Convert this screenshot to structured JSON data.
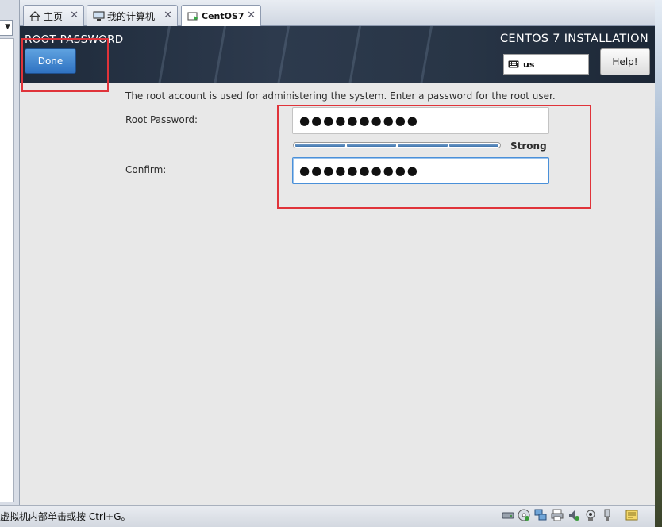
{
  "tabs": [
    {
      "label": "主页",
      "icon": "home-icon"
    },
    {
      "label": "我的计算机",
      "icon": "computer-icon"
    },
    {
      "label": "CentOS7",
      "icon": "vm-icon"
    }
  ],
  "close_glyph": "✕",
  "dropdown_glyph": "▼",
  "screen_title": "ROOT PASSWORD",
  "done_label": "Done",
  "install_title": "CENTOS 7 INSTALLATION",
  "keyboard_layout": "us",
  "help_label": "Help!",
  "description": "The root account is used for administering the system.  Enter a password for the root user.",
  "root_password": {
    "label": "Root Password:",
    "value": "●●●●●●●●●●"
  },
  "confirm": {
    "label": "Confirm:",
    "value": "●●●●●●●●●●"
  },
  "strength": {
    "label": "Strong",
    "level": 1.0,
    "segments": 4
  },
  "status_text": "虚拟机内部单击或按 Ctrl+G。",
  "tray_icons": [
    "hard-disk-icon",
    "cd-drive-icon",
    "network-icon",
    "printer-icon",
    "sound-icon",
    "camera-icon",
    "usb-icon",
    "message-icon"
  ],
  "colors": {
    "annotation": "#e0333a",
    "done_button": "#3a7fcf",
    "banner": "#243144"
  }
}
